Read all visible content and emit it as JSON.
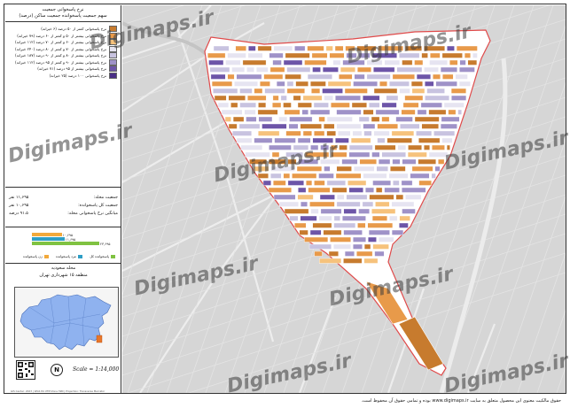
{
  "legend": {
    "title": "نرخ پاسخوانی جمعیت",
    "subtitle": "سهم جمعیت پاسخوانده جمعیت ساکن (درصد)",
    "classes": [
      {
        "label": "نرخ پاسخوانی کمتر از ۵۰ درصد (۶ خیرانه)",
        "color": "#c77b2e"
      },
      {
        "label": "نرخ پاسخوانی بیشتر از ۵۰ و کمتر از ۶۰ درصد (۷۹ خیرانه)",
        "color": "#e89a4a"
      },
      {
        "label": "نرخ پاسخوانی بیشتر از ۶۰ و کمتر از ۷۰ درصد (۱۱۲ خیرانه)",
        "color": "#f6c27c"
      },
      {
        "label": "نرخ پاسخوانی بیشتر از ۷۰ و کمتر از ۸۰ درصد (۲۴۰ خیرانه)",
        "color": "#e6e4f1"
      },
      {
        "label": "نرخ پاسخوانی بیشتر از ۸۰ و کمتر از ۹۰ درصد (۱۸۷ خیرانه)",
        "color": "#c8c3e0"
      },
      {
        "label": "نرخ پاسخوانی بیشتر از ۹۰ و کمتر از ۹۵ درصد (۱۱۲ خیرانه)",
        "color": "#9f92c8"
      },
      {
        "label": "نرخ پاسخوانی بیشتر از ۹۵ درصد (۷۱ خیرانه)",
        "color": "#6d55a8"
      },
      {
        "label": "نرخ پاسخوانی ۱۰۰ درصد (۲۵ خیرانه)",
        "color": "#4a2f86"
      }
    ]
  },
  "stats": [
    {
      "label": "جمعیت محله:",
      "value": "۱۱,۶۹۵ نفر"
    },
    {
      "label": "جمعیت کل پاسخوانده:",
      "value": "۱۰,۶۹۵ نفر"
    },
    {
      "label": "میانگین نرخ پاسخوانی محله:",
      "value": "۹۱.۵ درصد"
    }
  ],
  "bars": {
    "items": [
      {
        "label": "۱۰,۶۹۵",
        "fraction": 0.42,
        "color": "#f2a93b"
      },
      {
        "label": "۱۱,۶۹۵",
        "fraction": 0.46,
        "color": "#2e9ec6"
      },
      {
        "label": "۲۳,۶۹۵",
        "fraction": 0.95,
        "color": "#7fc241"
      }
    ],
    "legend": [
      {
        "label": "زن پاسخوانده",
        "color": "#f2a93b"
      },
      {
        "label": "مرد پاسخوانده",
        "color": "#2e9ec6"
      },
      {
        "label": "پاسخوانده کل",
        "color": "#7fc241"
      }
    ]
  },
  "region": {
    "name": "محله سعودیه",
    "district": "منطقه ۱۵ شهرداری تهران"
  },
  "scale": "Scale = 1:14,000",
  "north": "N",
  "credit": "GIS Center: 2023 | WGS 84 UTM Zone 39N | Projection: Transverse Mercator",
  "watermark": "Digimaps.ir",
  "footer": "حقوق مالکیت معنوی این محصول متعلق به سایت www.digimaps.ir بوده و تمامی حقوق آن محفوظ است.",
  "colors": {
    "boundary": "#e04a4a",
    "map_background": "#d9d9d9",
    "inset_region": "#8fb2ef",
    "inset_highlight": "#e8762a"
  }
}
